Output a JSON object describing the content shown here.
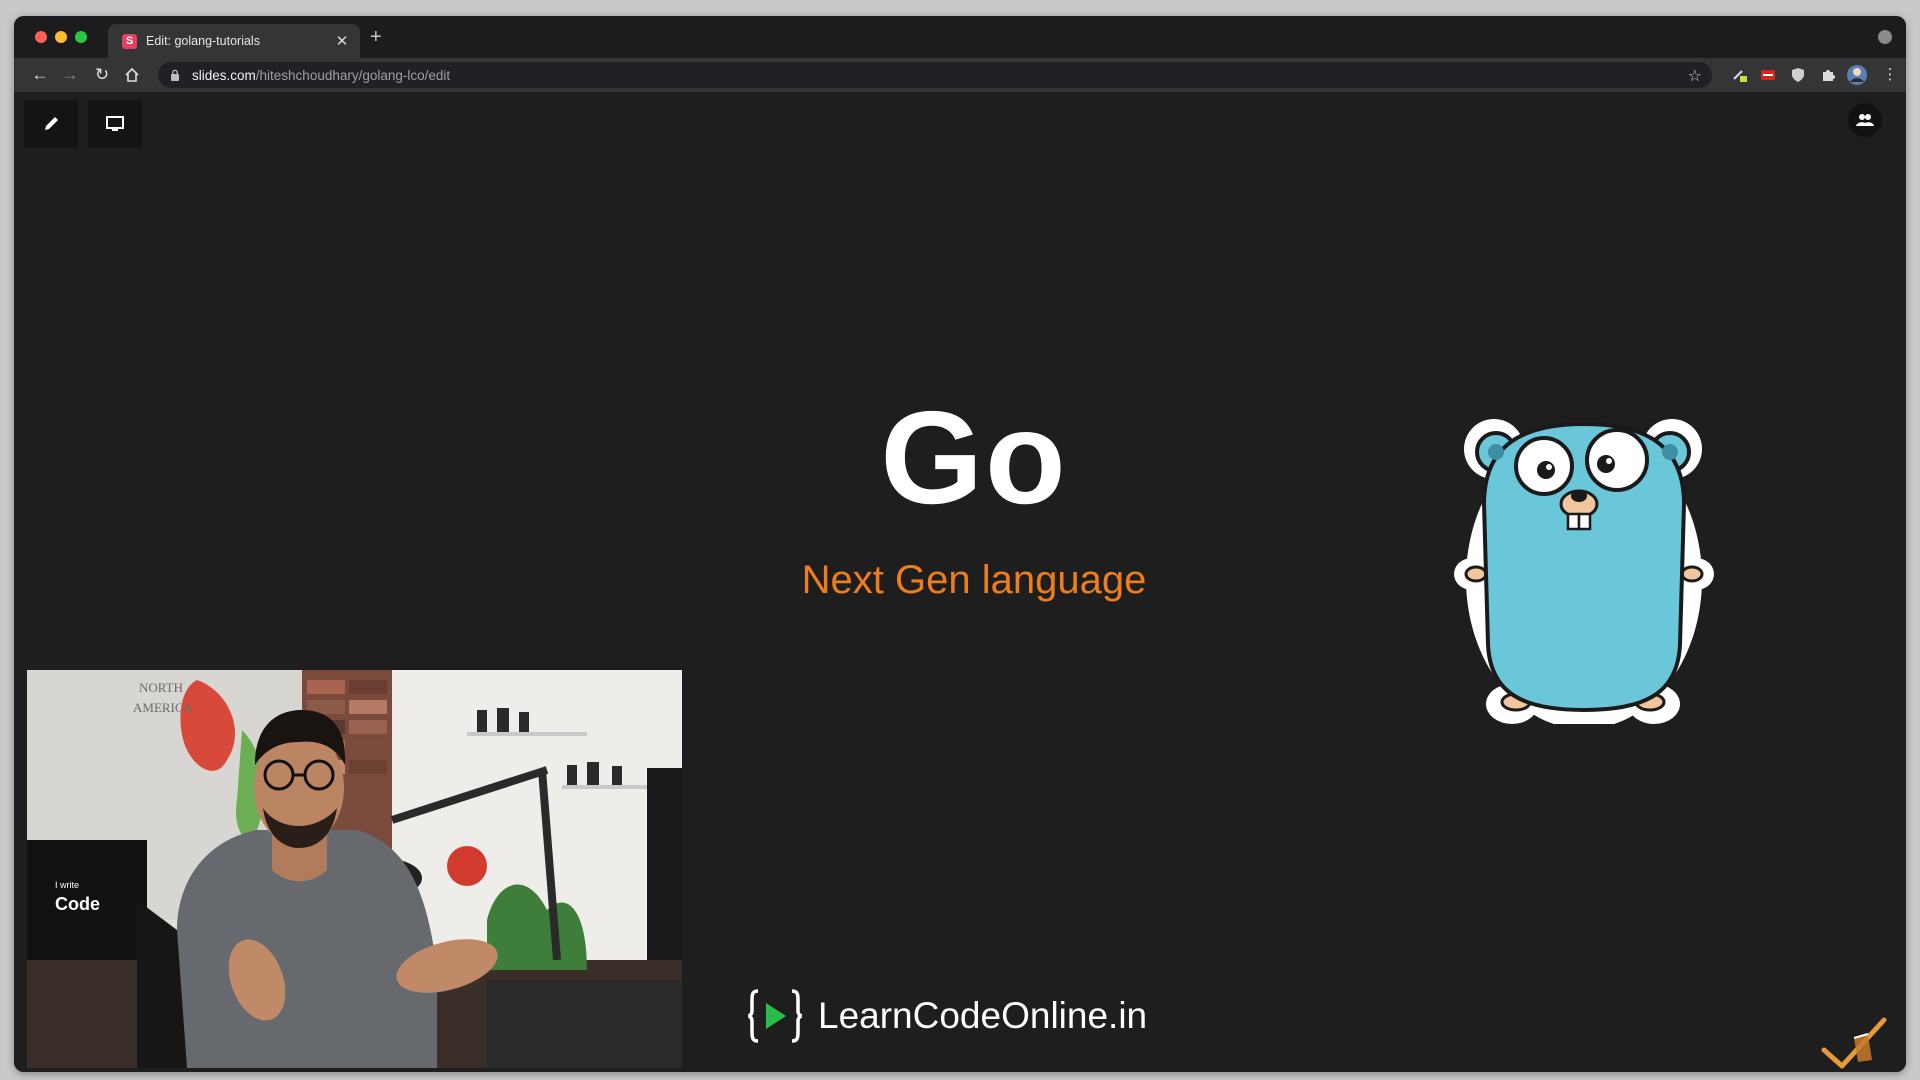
{
  "browser": {
    "tab": {
      "favicon_letter": "S",
      "title": "Edit: golang-tutorials"
    },
    "url": {
      "host": "slides.com",
      "path": "/hiteshchoudhary/golang-lco/edit"
    }
  },
  "slide": {
    "title": "Go",
    "subtitle": "Next Gen language"
  },
  "webcam": {
    "map_label_1": "NORTH",
    "map_label_2": "AMERICA",
    "monitor_text_small": "I write",
    "monitor_text_large": "Code"
  },
  "brand": {
    "text": "LearnCodeOnline.in"
  },
  "colors": {
    "background": "#1e1e1e",
    "subtitle_accent": "#ef7d1a",
    "gopher_body": "#6ac7d9",
    "brand_play": "#2bbd4a"
  }
}
